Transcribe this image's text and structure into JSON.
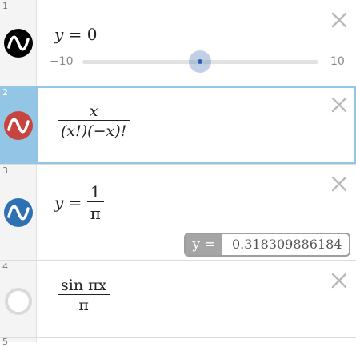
{
  "colors": {
    "selected_accent": "#92c6e4",
    "expr1_color": "#000000",
    "expr2_color": "#c74440",
    "expr3_color": "#2d70b3",
    "slider_thumb": "#2f5fae"
  },
  "expressions": [
    {
      "index": "1",
      "icon": "wave-graph-icon",
      "lhs": "y",
      "eq": "=",
      "rhs": "0",
      "slider": {
        "min_label": "−10",
        "max_label": "10",
        "min": -10,
        "max": 10,
        "value": 0
      }
    },
    {
      "index": "2",
      "icon": "wave-graph-icon",
      "numerator": "x",
      "denominator": "(x!)(−x)!"
    },
    {
      "index": "3",
      "icon": "wave-graph-icon",
      "lhs": "y",
      "eq": "=",
      "numerator": "1",
      "denominator": "π",
      "evaluation": {
        "label": "y =",
        "value": "0.318309886184"
      }
    },
    {
      "index": "4",
      "icon": "hidden-circle-icon",
      "numerator": "sin πx",
      "denominator": "π"
    },
    {
      "index": "5"
    }
  ],
  "close_icon": "close-icon"
}
